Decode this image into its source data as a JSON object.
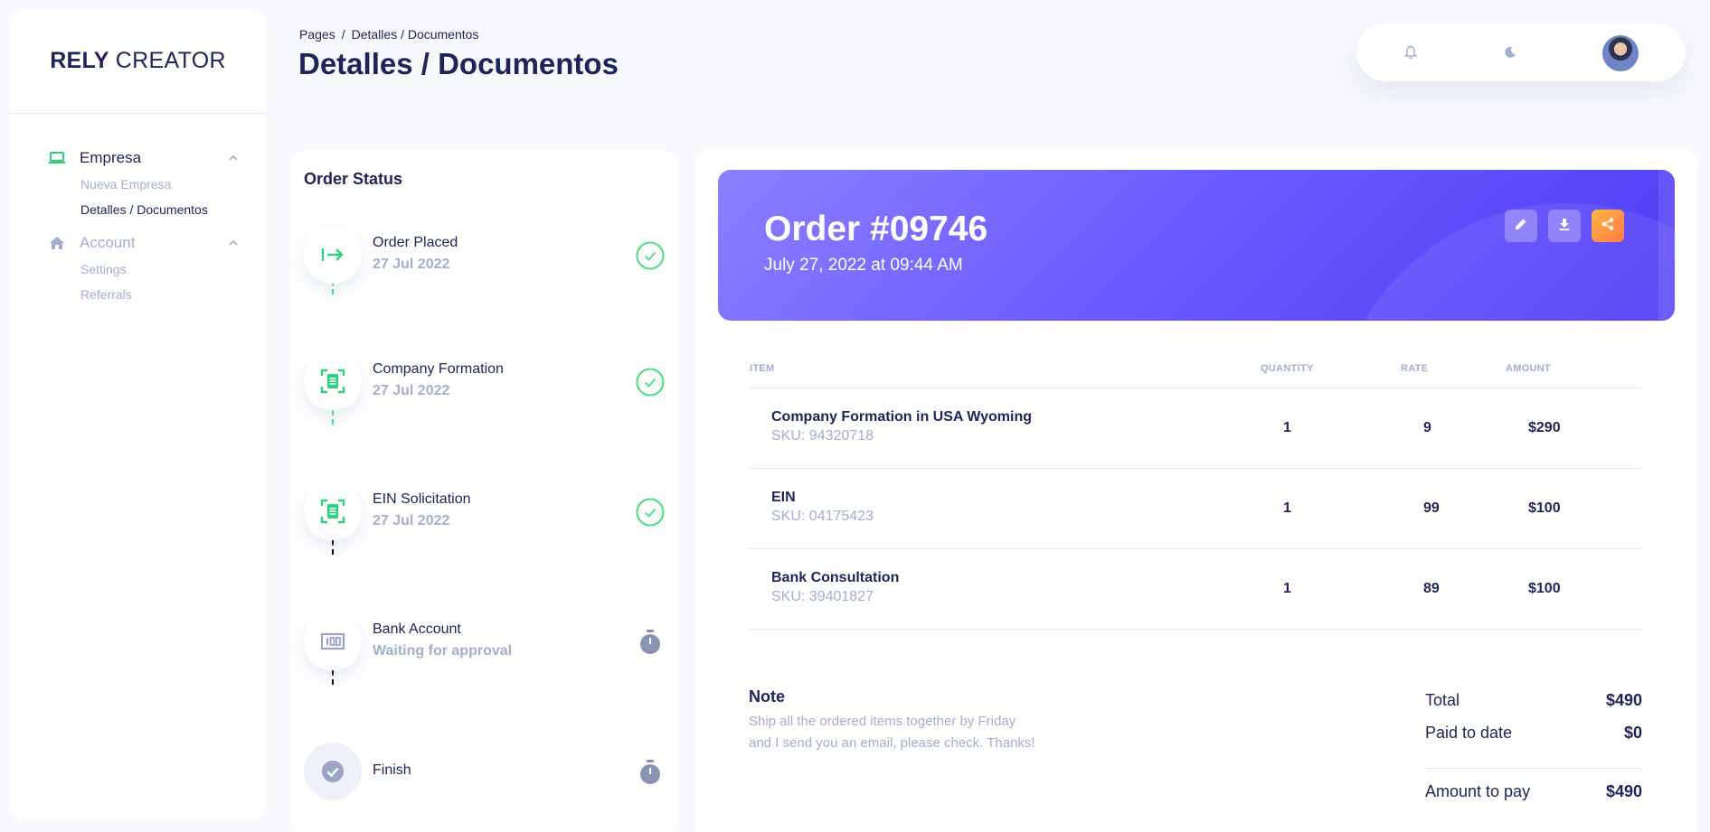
{
  "brand": {
    "bold": "RELY",
    "light": "CREATOR"
  },
  "sidebar": {
    "groups": [
      {
        "label": "Empresa",
        "items": [
          {
            "label": "Nueva Empresa"
          },
          {
            "label": "Detalles / Documentos"
          }
        ]
      },
      {
        "label": "Account",
        "items": [
          {
            "label": "Settings"
          },
          {
            "label": "Referrals"
          }
        ]
      }
    ]
  },
  "header": {
    "breadcrumb": {
      "root": "Pages",
      "separator": "/",
      "current": "Detalles / Documentos"
    },
    "title": "Detalles / Documentos"
  },
  "topbar": {
    "icons": [
      "bell-icon",
      "moon-icon"
    ],
    "avatar": "user-avatar"
  },
  "order_status": {
    "title": "Order Status",
    "steps": [
      {
        "title": "Order Placed",
        "subtitle": "27 Jul 2022",
        "icon": "arrow-right-to-bar-icon",
        "status": "done"
      },
      {
        "title": "Company Formation",
        "subtitle": "27 Jul 2022",
        "icon": "document-scan-icon",
        "status": "done"
      },
      {
        "title": "EIN Solicitation",
        "subtitle": "27 Jul 2022",
        "icon": "document-scan-icon",
        "status": "done"
      },
      {
        "title": "Bank Account",
        "subtitle": "Waiting for approval",
        "icon": "bank-icon",
        "status": "pending"
      },
      {
        "title": "Finish",
        "subtitle": "",
        "icon": "check-circle-icon",
        "status": "pending"
      }
    ]
  },
  "invoice": {
    "order_number": "Order #09746",
    "order_date": "July 27, 2022 at 09:44 AM",
    "actions": [
      "edit-icon",
      "download-icon",
      "share-icon"
    ],
    "columns": {
      "item": "ITEM",
      "quantity": "QUANTITY",
      "rate": "RATE",
      "amount": "AMOUNT"
    },
    "rows": [
      {
        "name": "Company Formation in USA Wyoming",
        "sku": "SKU: 94320718",
        "quantity": "1",
        "rate": "9",
        "amount": "$290"
      },
      {
        "name": "EIN",
        "sku": "SKU: 04175423",
        "quantity": "1",
        "rate": "99",
        "amount": "$100"
      },
      {
        "name": "Bank Consultation",
        "sku": "SKU: 39401827",
        "quantity": "1",
        "rate": "89",
        "amount": "$100"
      }
    ],
    "note": {
      "title": "Note",
      "line1": "Ship all the ordered items together by Friday",
      "line2": "and I send you an email, please check. Thanks!"
    },
    "totals": {
      "total_label": "Total",
      "total_value": "$490",
      "paid_label": "Paid to date",
      "paid_value": "$0",
      "due_label": "Amount to pay",
      "due_value": "$490"
    }
  },
  "colors": {
    "accent": "#6c5cff",
    "success": "#4ade80",
    "muted": "#a3aed0",
    "text": "#1b2559",
    "warning": "#ff7a45"
  }
}
